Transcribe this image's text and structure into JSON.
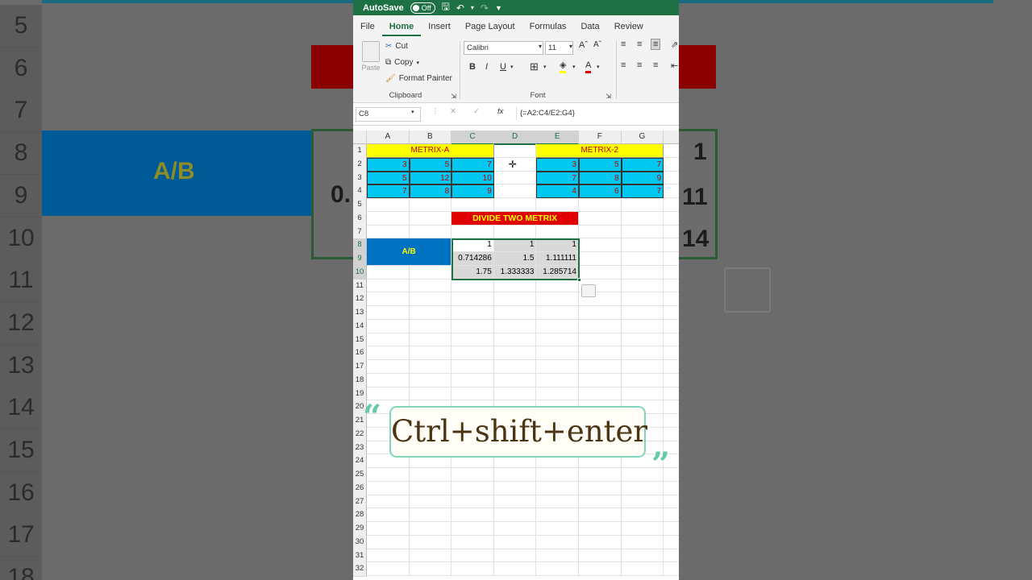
{
  "titlebar": {
    "autosave_label": "AutoSave",
    "autosave_state": "Off"
  },
  "tabs": [
    "File",
    "Home",
    "Insert",
    "Page Layout",
    "Formulas",
    "Data",
    "Review"
  ],
  "ribbon": {
    "clipboard": {
      "paste": "Paste",
      "cut": "Cut",
      "copy": "Copy",
      "format_painter": "Format Painter",
      "label": "Clipboard"
    },
    "font": {
      "name": "Calibri",
      "size": "11",
      "label": "Font",
      "bold": "B",
      "italic": "I",
      "underline": "U"
    }
  },
  "formula_bar": {
    "name_box": "C8",
    "fx": "fx",
    "formula": "{=A2:C4/E2:G4}"
  },
  "columns": [
    "A",
    "B",
    "C",
    "D",
    "E",
    "F",
    "G"
  ],
  "rows": [
    "1",
    "2",
    "3",
    "4",
    "5",
    "6",
    "7",
    "8",
    "9",
    "10",
    "11",
    "12",
    "13",
    "14",
    "15",
    "16",
    "17",
    "18",
    "19",
    "20",
    "21",
    "22",
    "23",
    "24",
    "25",
    "26",
    "27",
    "28",
    "29",
    "30",
    "31",
    "32"
  ],
  "sheet": {
    "matrix_a_title": "METRIX-A",
    "matrix_b_title": "METRIX-2",
    "matrix_a": [
      [
        "3",
        "5",
        "7"
      ],
      [
        "5",
        "12",
        "10"
      ],
      [
        "7",
        "8",
        "9"
      ]
    ],
    "matrix_b": [
      [
        "3",
        "5",
        "7"
      ],
      [
        "7",
        "8",
        "9"
      ],
      [
        "4",
        "6",
        "7"
      ]
    ],
    "divide_title": "DIVIDE TWO METRIX",
    "ab_label": "A/B",
    "result": [
      [
        "1",
        "1",
        "1"
      ],
      [
        "0.714286",
        "1.5",
        "1.111111"
      ],
      [
        "1.75",
        "1.333333",
        "1.285714"
      ]
    ]
  },
  "background": {
    "rows": [
      "5",
      "6",
      "7",
      "8",
      "9",
      "10",
      "11",
      "12",
      "13",
      "14",
      "15",
      "16",
      "17",
      "18"
    ],
    "ab_label": "A/B",
    "partial_09": "0.",
    "right_values": [
      "1",
      "11",
      "14"
    ]
  },
  "overlay": {
    "callout": "Ctrl+shift+enter"
  },
  "colors": {
    "excel_green": "#1e7145",
    "cyan": "#00c8f0",
    "yellow": "#ffff00",
    "red": "#e00000",
    "blue": "#0070c0"
  }
}
